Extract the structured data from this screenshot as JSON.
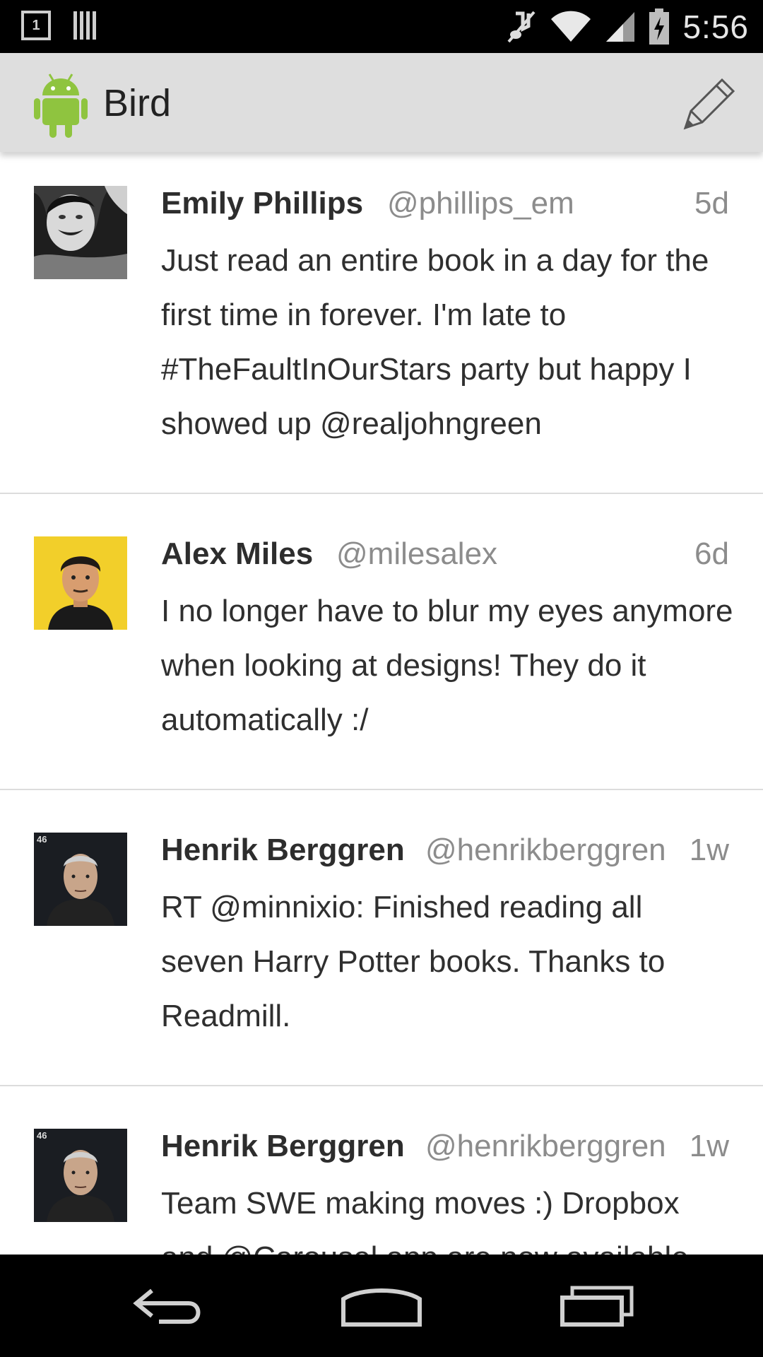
{
  "status_bar": {
    "notification_count": "1",
    "time": "5:56",
    "icons": [
      "notification-box-icon",
      "barcode-icon",
      "mute-icon",
      "wifi-icon",
      "signal-icon",
      "battery-charging-icon"
    ]
  },
  "action_bar": {
    "title": "Bird",
    "app_icon": "android-icon",
    "compose_icon": "pencil-icon"
  },
  "tweets": [
    {
      "name": "Emily Phillips",
      "handle": "@phillips_em",
      "time": "5d",
      "text": "Just read an entire book in a day for the first time in forever. I'm late to #TheFaultInOurStars party but happy I showed up @realjohngreen"
    },
    {
      "name": "Alex Miles",
      "handle": "@milesalex",
      "time": "6d",
      "text": "I no longer have to blur my eyes anymore when looking at designs! They do it automatically :/"
    },
    {
      "name": "Henrik Berggren",
      "handle": "@henrikberggren",
      "time": "1w",
      "text": "RT @minnixio: Finished reading all seven Harry Potter books. Thanks to Readmill."
    },
    {
      "name": "Henrik Berggren",
      "handle": "@henrikberggren",
      "time": "1w",
      "text": "Team SWE making moves :) Dropbox and @Carousel app are now available"
    }
  ],
  "colors": {
    "action_bar_bg": "#dedede",
    "avatar_yellow": "#f2cf2a",
    "android_green": "#8fc43f"
  },
  "nav_bar": {
    "icons": [
      "back-icon",
      "home-icon",
      "recent-apps-icon"
    ]
  }
}
